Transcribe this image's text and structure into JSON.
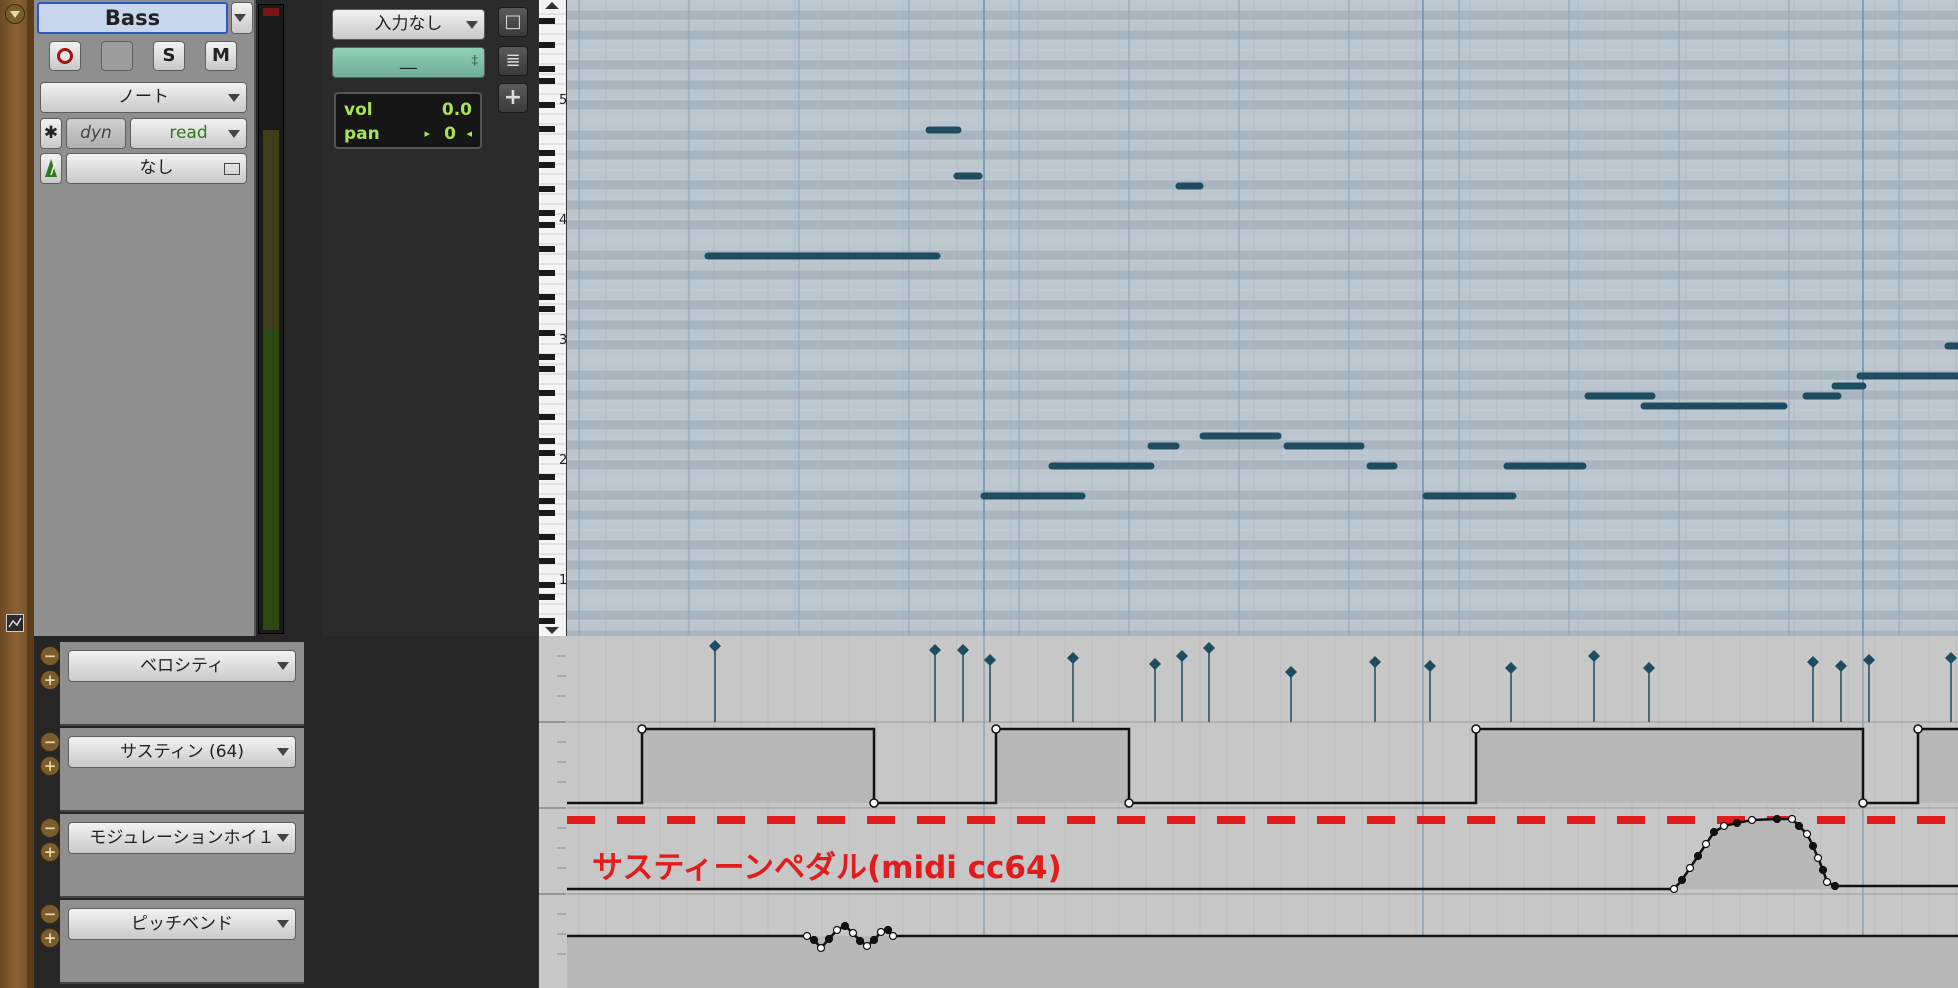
{
  "track": {
    "name": "Bass",
    "rec_icon": "record-icon",
    "solo_label": "S",
    "mute_label": "M",
    "view_mode": "ノート",
    "dyn_label": "dyn",
    "automation_mode": "read",
    "playlist": "なし"
  },
  "io": {
    "input": "入力なし",
    "output": "__",
    "vol_label": "vol",
    "vol_value": "0.0",
    "pan_label": "pan",
    "pan_value": "0"
  },
  "piano_roll": {
    "octave_labels": [
      "5",
      "4",
      "3",
      "2",
      "1"
    ]
  },
  "lanes": [
    {
      "label": "ベロシティ",
      "type": "velocity"
    },
    {
      "label": "サスティン (64)",
      "type": "sustain"
    },
    {
      "label": "モジュレーションホイ１",
      "type": "modulation"
    },
    {
      "label": "ピッチベンド",
      "type": "pitchbend"
    }
  ],
  "annotation": "サスティーンペダル(midi cc64)",
  "colors": {
    "note": "#1e4c60",
    "annotation": "#e01c1c",
    "selected_track": "#2a59c6",
    "meter": "#2b4a12"
  }
}
